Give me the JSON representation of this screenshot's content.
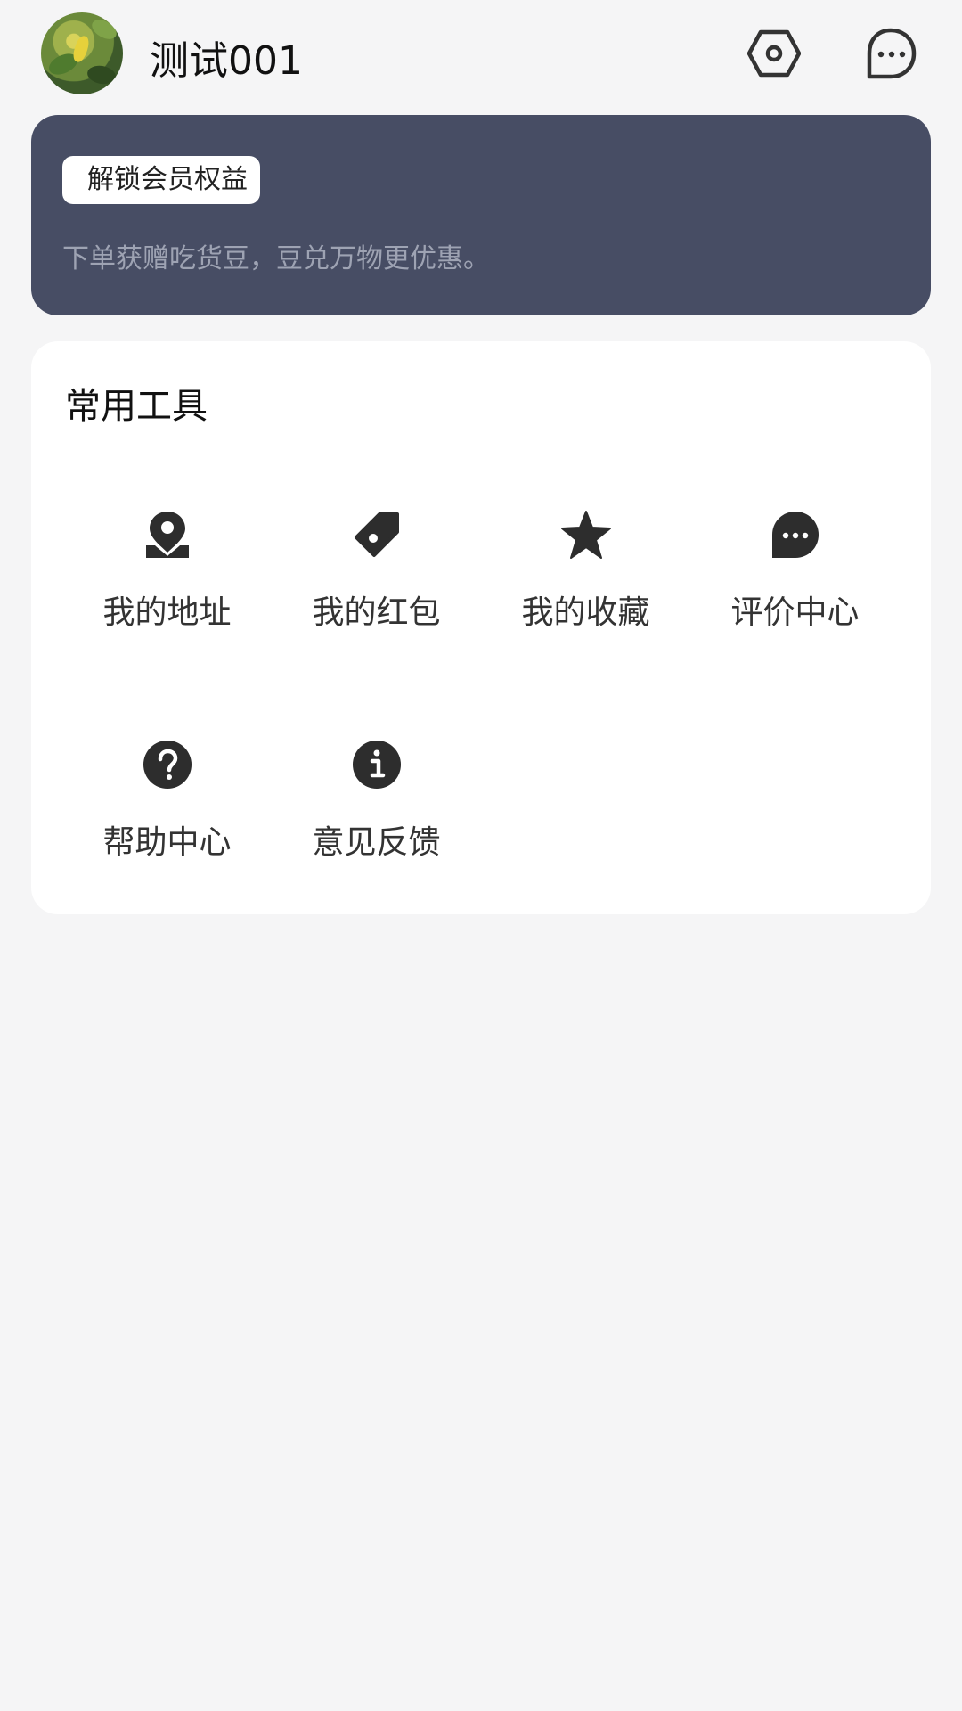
{
  "header": {
    "username": "测试001",
    "settings_icon": "settings-hexagon-icon",
    "message_icon": "message-bubble-icon"
  },
  "vip": {
    "tag": "解锁会员权益",
    "desc": "下单获赠吃货豆，豆兑万物更优惠。",
    "bg_color": "#474d64"
  },
  "tools": {
    "title": "常用工具",
    "items": [
      {
        "label": "我的地址",
        "icon": "location-pin-icon"
      },
      {
        "label": "我的红包",
        "icon": "tag-icon"
      },
      {
        "label": "我的收藏",
        "icon": "star-icon"
      },
      {
        "label": "评价中心",
        "icon": "comment-bubble-icon"
      },
      {
        "label": "帮助中心",
        "icon": "help-circle-icon"
      },
      {
        "label": "意见反馈",
        "icon": "info-circle-icon"
      }
    ]
  }
}
